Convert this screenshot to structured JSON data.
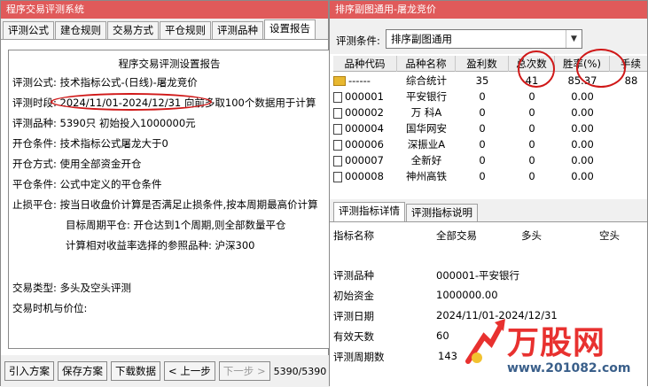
{
  "left_window": {
    "title": "程序交易评测系统",
    "tabs": [
      "评测公式",
      "建仓规则",
      "交易方式",
      "平仓规则",
      "评测品种",
      "设置报告"
    ],
    "active_tab_index": 5,
    "report": {
      "title": "程序交易评测设置报告",
      "formula": "评测公式:  技术指标公式-(日线)-屠龙竞价",
      "period": "评测时段:  2024/11/01-2024/12/31 向前多取100个数据用于计算",
      "varieties": "评测品种:  5390只 初始投入1000000元",
      "open_condition": "开仓条件:  技术指标公式屠龙大于0",
      "open_method": "开仓方式:  使用全部资金开仓",
      "close_condition": "平仓条件:  公式中定义的平仓条件",
      "stop_loss": "止损平仓:  按当日收盘价计算是否满足止损条件,按本周期最高价计算",
      "target_period": "目标周期平仓:  开仓达到1个周期,则全部数量平仓",
      "benchmark": "计算相对收益率选择的参照品种:  沪深300",
      "trade_type": "交易类型:  多头及空头评测",
      "trade_timing": "交易时机与价位:"
    },
    "buttons": {
      "import": "引入方案",
      "save": "保存方案",
      "download": "下载数据",
      "prev": "< 上一步",
      "next": "下一步 >"
    },
    "counter": "5390/5390"
  },
  "right_window": {
    "title": "排序副图通用-屠龙竞价",
    "condition_label": "评测条件:",
    "condition_value": "排序副图通用",
    "columns": [
      "品种代码",
      "品种名称",
      "盈利数",
      "总次数",
      "胜率(%)",
      "手续"
    ],
    "rows": [
      {
        "code": "------",
        "name": "综合统计",
        "profit": "35",
        "total": "41",
        "win_rate": "85.37",
        "fee": "88"
      },
      {
        "code": "000001",
        "name": "平安银行",
        "profit": "0",
        "total": "0",
        "win_rate": "0.00",
        "fee": ""
      },
      {
        "code": "000002",
        "name": "万 科A",
        "profit": "0",
        "total": "0",
        "win_rate": "0.00",
        "fee": ""
      },
      {
        "code": "000004",
        "name": "国华网安",
        "profit": "0",
        "total": "0",
        "win_rate": "0.00",
        "fee": ""
      },
      {
        "code": "000006",
        "name": "深振业A",
        "profit": "0",
        "total": "0",
        "win_rate": "0.00",
        "fee": ""
      },
      {
        "code": "000007",
        "name": "全新好",
        "profit": "0",
        "total": "0",
        "win_rate": "0.00",
        "fee": ""
      },
      {
        "code": "000008",
        "name": "神州高铁",
        "profit": "0",
        "total": "0",
        "win_rate": "0.00",
        "fee": ""
      }
    ],
    "detail_tabs": [
      "评测指标详情",
      "评测指标说明"
    ],
    "detail_header": {
      "name": "指标名称",
      "all": "全部交易",
      "long": "多头",
      "short": "空头"
    },
    "detail_rows": [
      {
        "label": "评测品种",
        "value": "000001-平安银行"
      },
      {
        "label": "初始资金",
        "value": "1000000.00"
      },
      {
        "label": "评测日期",
        "value": "2024/11/01-2024/12/31"
      },
      {
        "label": "有效天数",
        "value": "60"
      },
      {
        "label": "评测周期数",
        "value": "143"
      }
    ]
  },
  "watermark": {
    "brand": "万股网",
    "url": "www.201082.com"
  },
  "colors": {
    "titlebar": "#e05a5a",
    "annotation": "#d01818",
    "watermark": "#e8312f"
  }
}
